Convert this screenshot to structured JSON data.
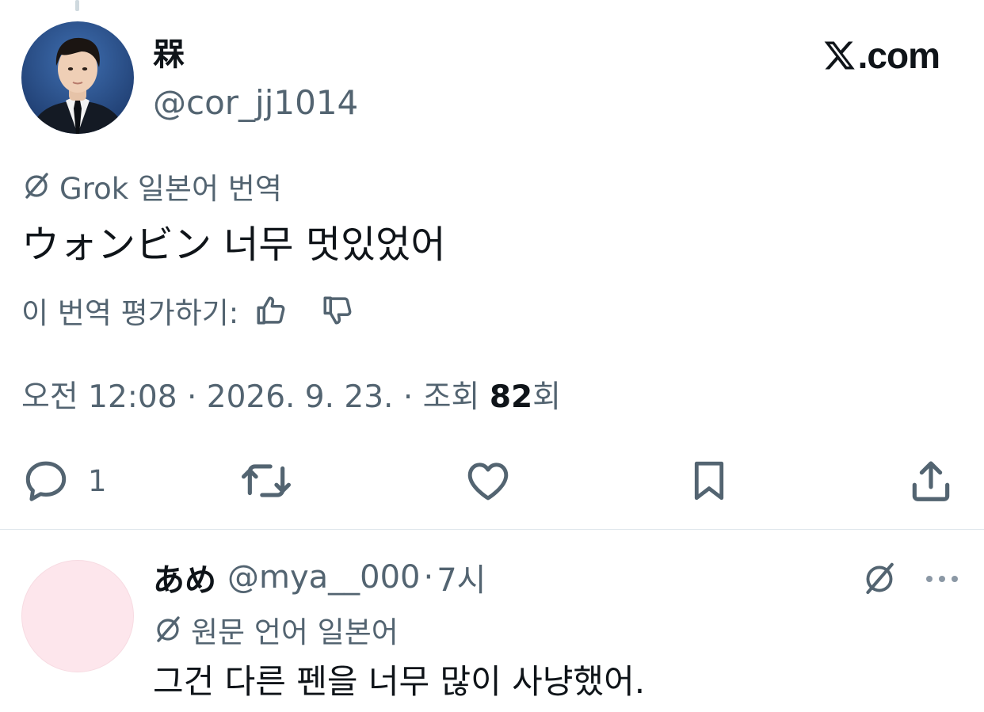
{
  "tweet": {
    "display_name": "槑",
    "handle": "@cor_jj1014",
    "site_label": ".com",
    "grok_label": "Grok 일본어 번역",
    "translated_text": "ウォンビン 너무 멋있었어",
    "rate_label": "이 번역 평가하기:",
    "meta": {
      "time": "오전 12:08",
      "separator": " · ",
      "date": "2026. 9. 23.",
      "views_prefix": "조회 ",
      "views_count": "82",
      "views_suffix": "회"
    },
    "actions": {
      "reply_count": "1"
    }
  },
  "reply": {
    "display_name": "あめ",
    "handle": "@mya__000",
    "separator": "·",
    "time": "7시",
    "lang_label": "원문 언어 일본어",
    "text": "그건 다른 펜을 너무 많이 사냥했어."
  },
  "icons": {
    "grok": "grok-icon",
    "like": "thumb-up-icon",
    "dislike": "thumb-down-icon",
    "reply": "reply-icon",
    "retweet": "retweet-icon",
    "heart": "heart-icon",
    "bookmark": "bookmark-icon",
    "share": "share-icon",
    "more": "more-icon"
  },
  "colors": {
    "text_primary": "#0f1419",
    "text_secondary": "#536471",
    "divider": "#e1e8ed",
    "reply_avatar": "#fde6ec"
  }
}
